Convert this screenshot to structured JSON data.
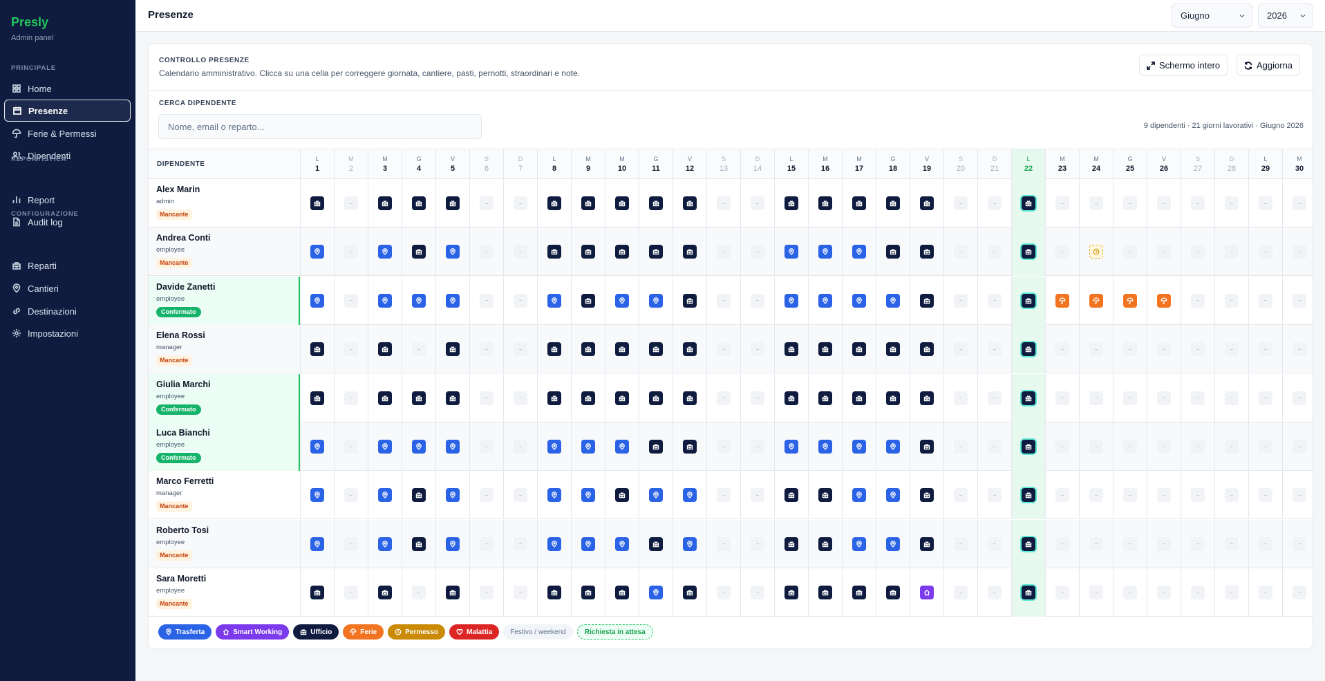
{
  "sidebar": {
    "brand": "Presly",
    "subtitle": "Admin panel",
    "sections": [
      {
        "label": "PRINCIPALE",
        "items": [
          {
            "label": "Home",
            "icon": "grid-icon"
          },
          {
            "label": "Presenze",
            "icon": "calendar-icon",
            "active": true
          },
          {
            "label": "Ferie & Permessi",
            "icon": "umbrella-icon"
          },
          {
            "label": "Dipendenti",
            "icon": "users-icon"
          }
        ]
      },
      {
        "label": "REPORTISTICA",
        "items": [
          {
            "label": "Report",
            "icon": "chart-icon"
          },
          {
            "label": "Audit log",
            "icon": "file-icon"
          }
        ]
      },
      {
        "label": "CONFIGURAZIONE",
        "items": [
          {
            "label": "Reparti",
            "icon": "building-icon"
          },
          {
            "label": "Cantieri",
            "icon": "pin-icon"
          },
          {
            "label": "Destinazioni",
            "icon": "link-icon"
          },
          {
            "label": "Impostazioni",
            "icon": "gear-icon"
          }
        ]
      }
    ]
  },
  "topbar": {
    "title": "Presenze",
    "month": "Giugno",
    "year": "2026"
  },
  "card": {
    "eyebrow": "CONTROLLO PRESENZE",
    "description": "Calendario amministrativo. Clicca su una cella per correggere giornata, cantiere, pasti, pernotti, straordinari e note.",
    "fullscreen_label": "Schermo intero",
    "refresh_label": "Aggiorna",
    "search_label": "CERCA DIPENDENTE",
    "search_placeholder": "Nome, email o reparto...",
    "summary": "9 dipendenti · 21 giorni lavorativi · Giugno 2026"
  },
  "grid": {
    "name_header": "DIPENDENTE",
    "today": 22,
    "days": [
      {
        "n": 1,
        "l": "L"
      },
      {
        "n": 2,
        "l": "M"
      },
      {
        "n": 3,
        "l": "M"
      },
      {
        "n": 4,
        "l": "G"
      },
      {
        "n": 5,
        "l": "V"
      },
      {
        "n": 6,
        "l": "S"
      },
      {
        "n": 7,
        "l": "D"
      },
      {
        "n": 8,
        "l": "L"
      },
      {
        "n": 9,
        "l": "M"
      },
      {
        "n": 10,
        "l": "M"
      },
      {
        "n": 11,
        "l": "G"
      },
      {
        "n": 12,
        "l": "V"
      },
      {
        "n": 13,
        "l": "S"
      },
      {
        "n": 14,
        "l": "D"
      },
      {
        "n": 15,
        "l": "L"
      },
      {
        "n": 16,
        "l": "M"
      },
      {
        "n": 17,
        "l": "M"
      },
      {
        "n": 18,
        "l": "G"
      },
      {
        "n": 19,
        "l": "V"
      },
      {
        "n": 20,
        "l": "S"
      },
      {
        "n": 21,
        "l": "D"
      },
      {
        "n": 22,
        "l": "L"
      },
      {
        "n": 23,
        "l": "M"
      },
      {
        "n": 24,
        "l": "M"
      },
      {
        "n": 25,
        "l": "G"
      },
      {
        "n": 26,
        "l": "V"
      },
      {
        "n": 27,
        "l": "S"
      },
      {
        "n": 28,
        "l": "D"
      },
      {
        "n": 29,
        "l": "L"
      },
      {
        "n": 30,
        "l": "M"
      }
    ],
    "weekend_days": [
      2,
      6,
      7,
      13,
      14,
      20,
      21,
      27,
      28
    ],
    "employees": [
      {
        "name": "Alex Marin",
        "role": "admin",
        "status": "Mancante",
        "confirmed": false,
        "cells": "UEUUUEEUUUUUEEUUUUUEEUEEEEEEEE"
      },
      {
        "name": "Andrea Conti",
        "role": "employee",
        "status": "Mancante",
        "confirmed": false,
        "cells": "TETUTEEUUUUUEETTTUUEEUEPEEEEEE"
      },
      {
        "name": "Davide Zanetti",
        "role": "employee",
        "status": "Confermato",
        "confirmed": true,
        "cells": "TETTTEETUTTUEETTTTUEEUFFFFEEEE"
      },
      {
        "name": "Elena Rossi",
        "role": "manager",
        "status": "Mancante",
        "confirmed": false,
        "cells": "UEUEUEEUUUUUEEUUUUUEEUEEEEEEEE"
      },
      {
        "name": "Giulia Marchi",
        "role": "employee",
        "status": "Confermato",
        "confirmed": true,
        "cells": "UEUUUEEUUUUUEEUUUUUEEUEEEEEEEE"
      },
      {
        "name": "Luca Bianchi",
        "role": "employee",
        "status": "Confermato",
        "confirmed": true,
        "cells": "TETTTEETTTUUEETTTTUEEUEEEEEEEE"
      },
      {
        "name": "Marco Ferretti",
        "role": "manager",
        "status": "Mancante",
        "confirmed": false,
        "cells": "TETUTEETTUTTEEUUTTUEEUEEEEEEEE"
      },
      {
        "name": "Roberto Tosi",
        "role": "employee",
        "status": "Mancante",
        "confirmed": false,
        "cells": "TETUTEETTTUTEEUUTTUEEUEEEEEEEE"
      },
      {
        "name": "Sara Moretti",
        "role": "employee",
        "status": "Mancante",
        "confirmed": false,
        "cells": "UEUEUEEUUUTUEEUUUUSEEUEEEEEEEE"
      }
    ]
  },
  "legend": [
    {
      "label": "Trasferta",
      "color": "#2b63e6",
      "icon": "pin-icon"
    },
    {
      "label": "Smart Working",
      "color": "#7c3aed",
      "icon": "home-icon"
    },
    {
      "label": "Ufficio",
      "color": "#0f1c3f",
      "icon": "building-icon"
    },
    {
      "label": "Ferie",
      "color": "#f27420",
      "icon": "umbrella-icon"
    },
    {
      "label": "Permesso",
      "color": "#ca8a04",
      "icon": "clock-icon"
    },
    {
      "label": "Malattia",
      "color": "#dc2626",
      "icon": "heart-icon"
    },
    {
      "label": "Festivo / weekend",
      "style": "ghost"
    },
    {
      "label": "Richiesta in attesa",
      "style": "pending"
    }
  ]
}
